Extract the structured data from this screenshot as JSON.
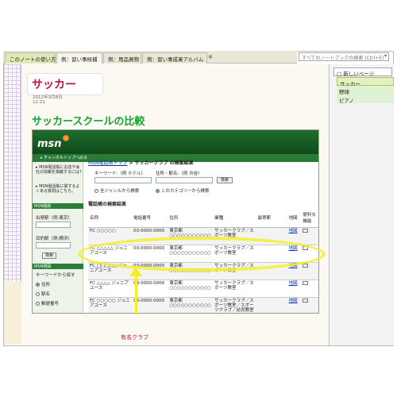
{
  "tabs": [
    {
      "label": "このノートの使い方"
    },
    {
      "label": "例：習い事候補"
    },
    {
      "label": "例：用品買物"
    },
    {
      "label": "例：習い事成果アルバム"
    }
  ],
  "search": {
    "placeholder": "すべてのノートブックの検索 (Ctrl+E)"
  },
  "page": {
    "title": "サッカー",
    "date": "2012年3月8日",
    "time": "12:21",
    "heading": "サッカースクールの比較",
    "annotation": "有名クラブ"
  },
  "msn": {
    "logo": "msn",
    "channel_link": "▸ チャンネルトップへ戻る",
    "left_notes": [
      "▸ MSN電話帳にお店や会社の情報を掲載するには?",
      "▸ MSN電話帳に関するよくある質問はこちら。"
    ],
    "left_head_1": "MSN路線",
    "depart_label": "出発駅（例:東京）",
    "arrive_label": "目的駅（例:横浜）",
    "search_btn": "検索",
    "left_head_2": "MSN地図",
    "keyword_find": "キーワードから探す",
    "radio_1": "住所",
    "radio_2": "駅名",
    "radio_3": "郵便番号",
    "breadcrumb_link": "MSN電話帳トップ",
    "breadcrumb_current": "> サッカークラブ の検索結果",
    "keyword_label": "キーワード:（例 ホテル）",
    "address_label": "住所・駅名:（例 渋谷）",
    "search_btn2": "検索",
    "genre_all": "全ジャンルから検索",
    "genre_this": "このカテゴリーから検索",
    "result_head": "電話帳の検索結果",
    "columns": [
      "名称",
      "電話番号",
      "住所",
      "業種",
      "最寄駅",
      "地図",
      "便利な機能"
    ],
    "rows": [
      {
        "name": "FC ○○○○○",
        "tel": "03-0000-0000",
        "addr": "東京都○○○○○○○○○○○",
        "type": "サッカークラブ／スポーツ教室",
        "map": "地図"
      },
      {
        "name": "FC △△△△△ ジュニアユース",
        "tel": "03-0000-0000",
        "addr": "東京都○○○○○○○○○○○",
        "type": "サッカークラブ／スポーツ教室",
        "map": "地図"
      },
      {
        "name": "FC □□□□□ ジュニアユース",
        "tel": "03-0000-0000",
        "addr": "東京都○○○○○○○○○○○",
        "type": "サッカークラブ／スポーツ教室",
        "map": "地図"
      },
      {
        "name": "FC △△△△ ジュニアユース",
        "tel": "03-0000-0000",
        "addr": "東京都○○○○○○○○○○○",
        "type": "サッカークラブ／スポーツ教室",
        "map": "地図"
      },
      {
        "name": "FC ○○○○○ ジュニアユース",
        "tel": "03-0000-0000",
        "addr": "東京都○○○○○○○○○○○",
        "type": "サッカークラブ／スポーツ教室／スポーツクラブ／幼児教室",
        "map": "地図"
      }
    ]
  },
  "right_pane": {
    "new_page": "新しいページ",
    "pages": [
      "サッカー",
      "野球",
      "ピアノ"
    ]
  },
  "colors": {
    "title": "#c0114d",
    "heading": "#12a430",
    "highlight": "#f5ef2a",
    "msn_green": "#1f6e2e"
  }
}
